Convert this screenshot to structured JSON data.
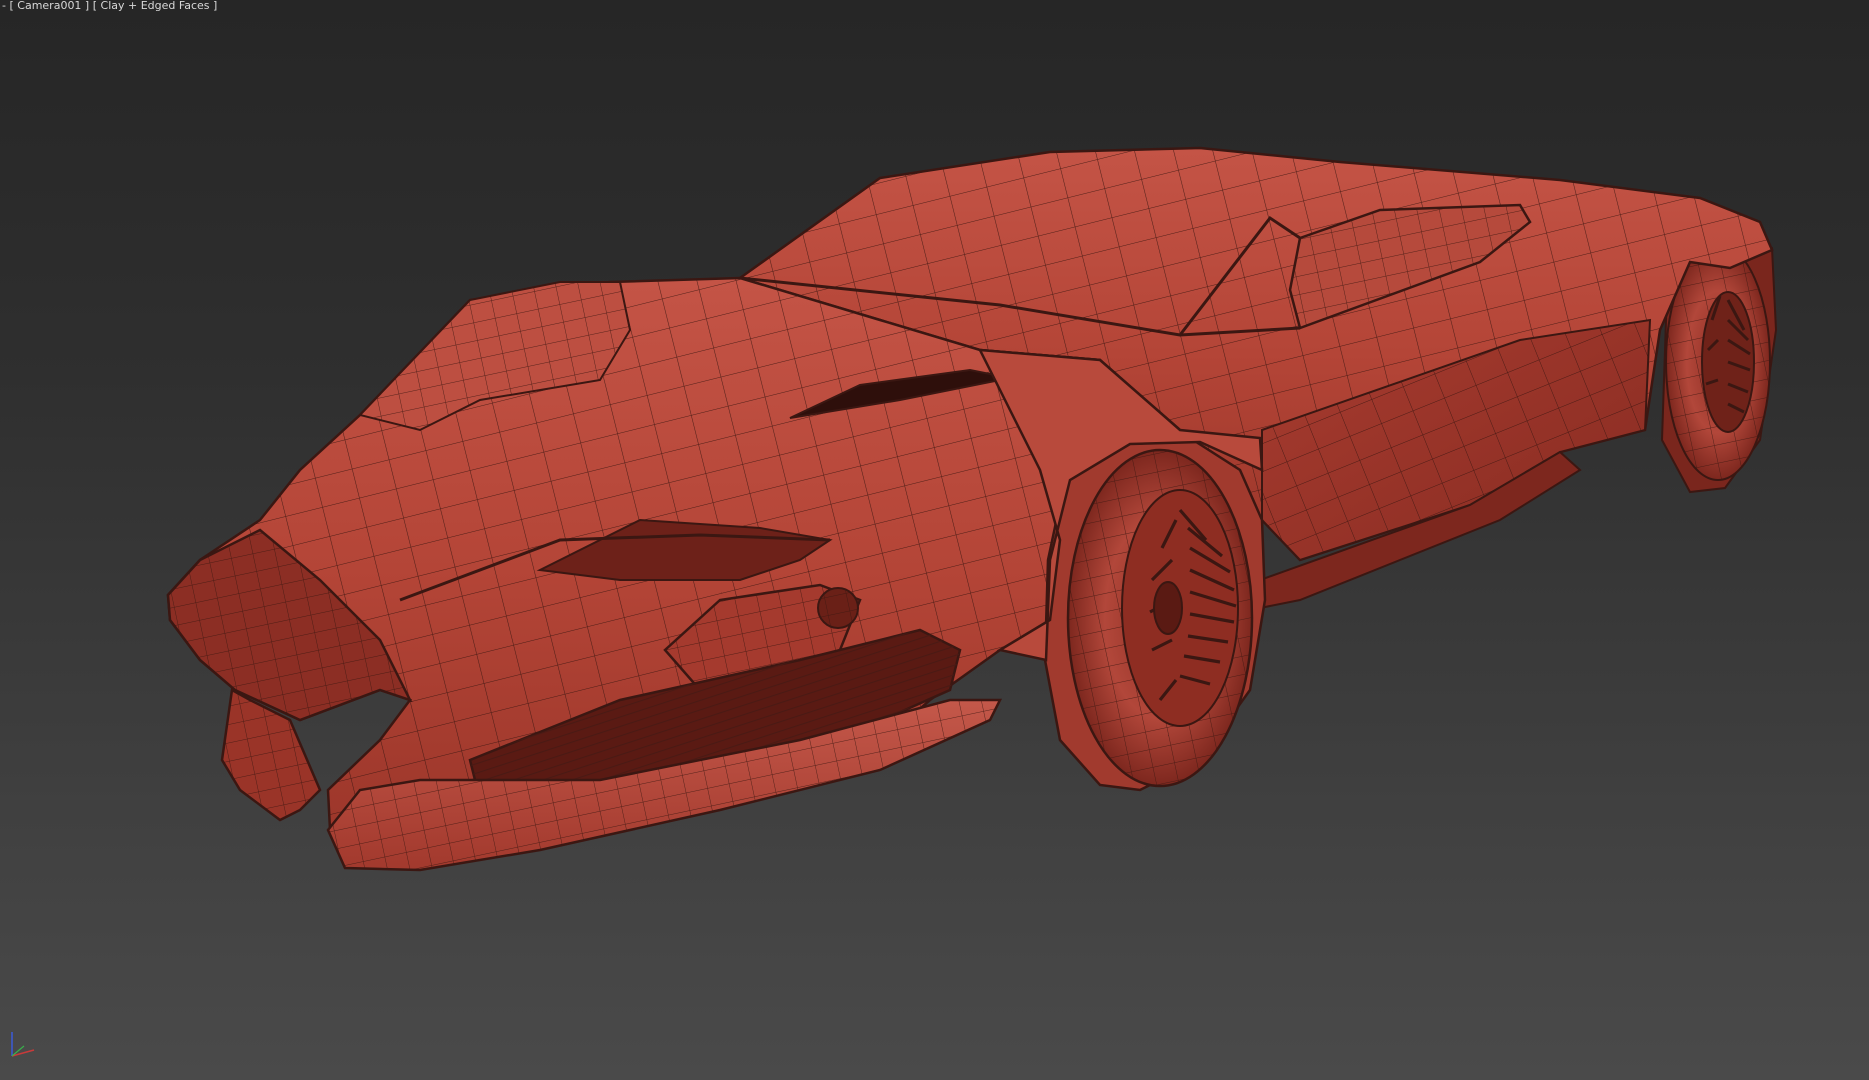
{
  "viewport": {
    "menu_label": "-",
    "camera_label": "[ Camera001 ]",
    "shading_label": "[ Clay + Edged Faces ]"
  },
  "scene": {
    "object": "car-model-clay-wireframe",
    "clay_color": "#b9473b",
    "edge_color": "#3b1712",
    "background_top": "#262626",
    "background_bottom": "#4a4a4a"
  },
  "axis_gizmo": {
    "x_color": "#c83a3a",
    "y_color": "#3ab04a",
    "z_color": "#3a5ad8"
  }
}
